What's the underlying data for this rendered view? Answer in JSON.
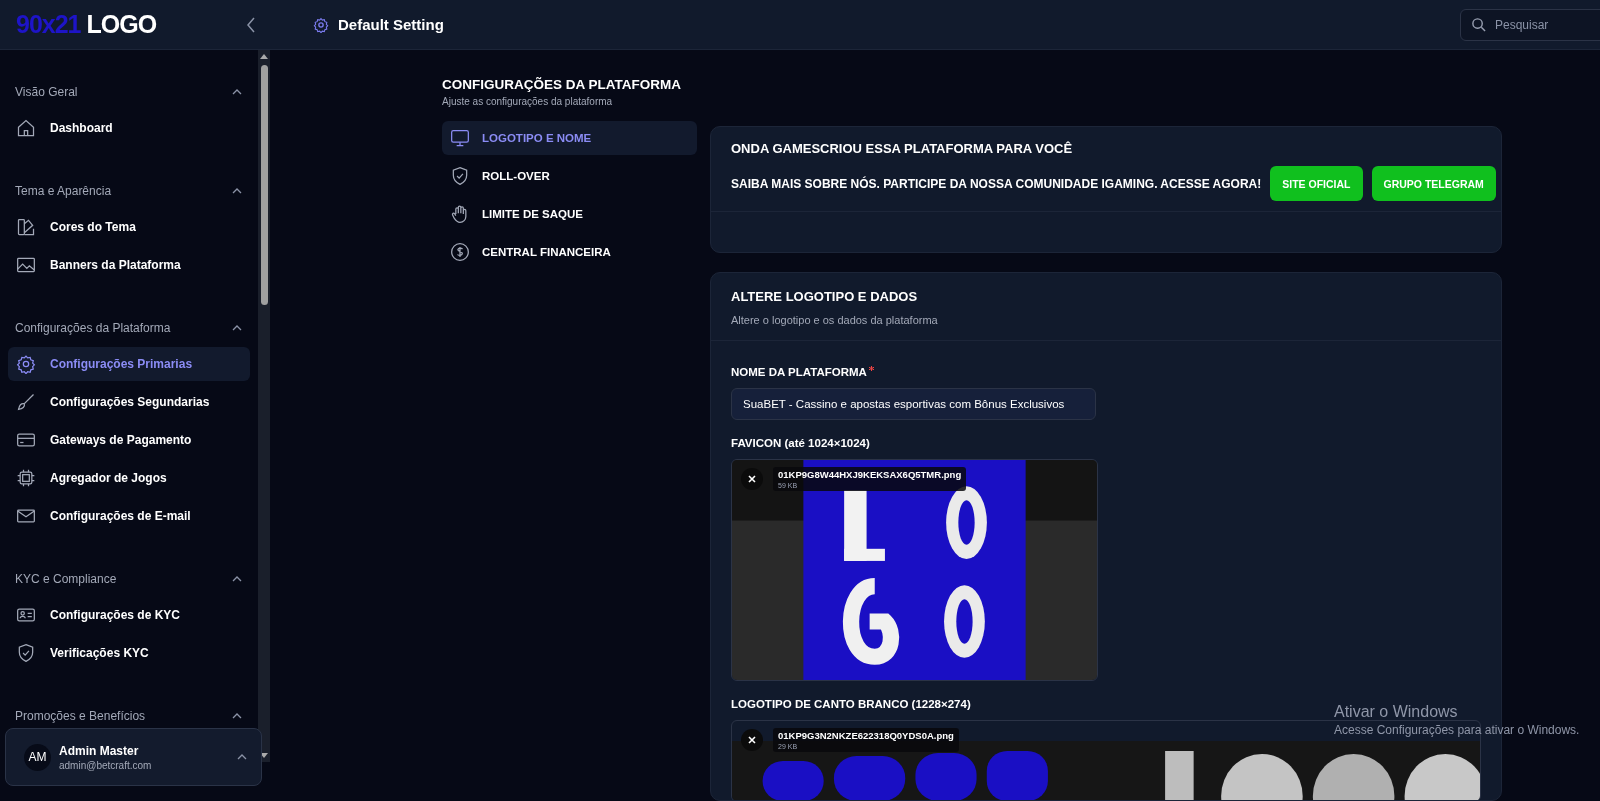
{
  "header": {
    "logo_part_1": "90x21",
    "logo_part_2": "LOGO",
    "page_title": "Default Setting",
    "search": {
      "placeholder": "Pesquisar"
    }
  },
  "sidebar": {
    "sections": [
      {
        "title": "Visão Geral",
        "expanded": true,
        "items": [
          {
            "label": "Dashboard",
            "selected": false
          }
        ]
      },
      {
        "title": "Tema e Aparência",
        "expanded": true,
        "items": [
          {
            "label": "Cores do Tema",
            "selected": false
          },
          {
            "label": "Banners da Plataforma",
            "selected": false
          }
        ]
      },
      {
        "title": "Configurações da Plataforma",
        "expanded": true,
        "items": [
          {
            "label": "Configurações Primarias",
            "selected": true
          },
          {
            "label": "Configurações Segundarias",
            "selected": false
          },
          {
            "label": "Gateways de Pagamento",
            "selected": false
          },
          {
            "label": "Agregador de Jogos",
            "selected": false
          },
          {
            "label": "Configurações de E-mail",
            "selected": false
          }
        ]
      },
      {
        "title": "KYC e Compliance",
        "expanded": true,
        "items": [
          {
            "label": "Configurações de KYC",
            "selected": false
          },
          {
            "label": "Verificações KYC",
            "selected": false
          }
        ]
      },
      {
        "title": "Promoções e Benefícios",
        "expanded": true
      }
    ],
    "user": {
      "initials": "AM",
      "name": "Admin Master",
      "email": "admin@betcraft.com"
    }
  },
  "settings": {
    "title": "CONFIGURAÇÕES DA PLATAFORMA",
    "subtitle": "Ajuste as configurações da plataforma",
    "tabs": [
      {
        "label": "LOGOTIPO E NOME",
        "selected": true
      },
      {
        "label": "ROLL-OVER",
        "selected": false
      },
      {
        "label": "LIMITE DE SAQUE",
        "selected": false
      },
      {
        "label": "CENTRAL FINANCEIRA",
        "selected": false
      }
    ]
  },
  "promo_card": {
    "title": "ONDA GAMESCRIOU ESSA PLATAFORMA PARA VOCÊ",
    "text": "SAIBA MAIS SOBRE NÓS. PARTICIPE DA NOSSA COMUNIDADE IGAMING. ACESSE AGORA!",
    "buttons": [
      "SITE OFICIAL",
      "GRUPO TELEGRAM"
    ]
  },
  "form_card": {
    "title": "ALTERE LOGOTIPO E DADOS",
    "subtitle": "Altere o logotipo e os dados da plataforma",
    "name_field": {
      "label": "NOME DA PLATAFORMA",
      "required": true,
      "value": "SuaBET - Cassino e apostas esportivas com Bônus Exclusivos"
    },
    "uploads": [
      {
        "label": "FAVICON (até 1024×1024)",
        "file_name": "01KP9G8W44HXJ9KEKSAX6Q5TMR.png",
        "size": "59 KB",
        "kind": "square"
      },
      {
        "label": "LOGOTIPO DE CANTO BRANCO (1228×274)",
        "file_name": "01KP9G3N2NKZE622318Q0YDS0A.png",
        "size": "29 KB",
        "kind": "wide"
      }
    ]
  },
  "os_overlay": {
    "title": "Ativar o Windows",
    "text": "Acesse Configurações para ativar o Windows."
  }
}
